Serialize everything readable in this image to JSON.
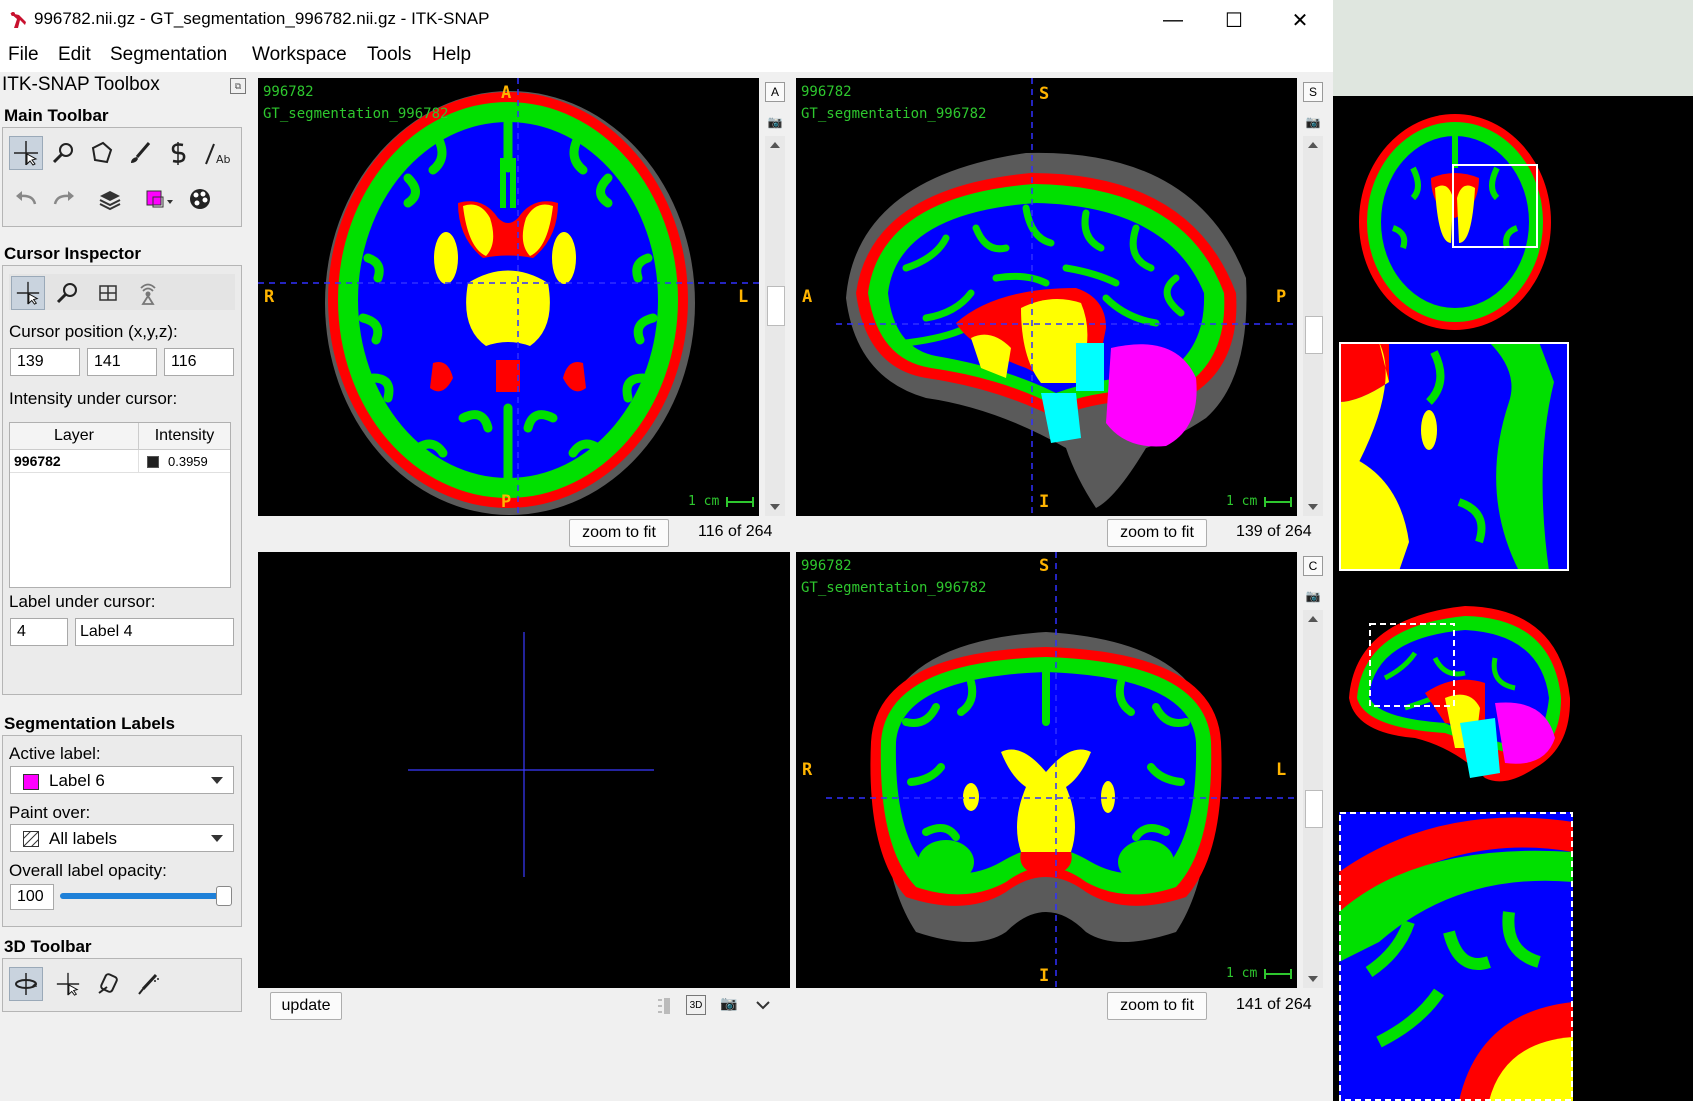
{
  "window": {
    "title": "996782.nii.gz - GT_segmentation_996782.nii.gz - ITK-SNAP",
    "minimize": "—",
    "maximize": "☐",
    "close": "✕"
  },
  "menu": [
    "File",
    "Edit",
    "Segmentation",
    "Workspace",
    "Tools",
    "Help"
  ],
  "toolbox": {
    "title": "ITK-SNAP Toolbox",
    "main_toolbar": "Main Toolbar",
    "cursor_inspector": {
      "title": "Cursor Inspector",
      "position_label": "Cursor position (x,y,z):",
      "x": "139",
      "y": "141",
      "z": "116",
      "intensity_label": "Intensity under cursor:",
      "table_headers": [
        "Layer",
        "Intensity"
      ],
      "rows": [
        {
          "layer": "996782",
          "intensity": "0.3959",
          "swatch": "#202020"
        }
      ],
      "label_under_cursor": "Label under cursor:",
      "label_id": "4",
      "label_name": "Label 4"
    },
    "segmentation_labels": {
      "title": "Segmentation Labels",
      "active_label_caption": "Active label:",
      "active_label": "Label 6",
      "active_color": "#ff00ff",
      "paint_over_caption": "Paint over:",
      "paint_over": "All labels",
      "opacity_caption": "Overall label opacity:",
      "opacity_value": "100",
      "opacity_fraction": 1.0
    },
    "toolbar_3d": "3D Toolbar"
  },
  "views": {
    "axial": {
      "image_name": "996782",
      "seg_name": "GT_segmentation_996782",
      "top": "A",
      "bottom": "P",
      "left": "R",
      "right": "L",
      "scale": "1 cm",
      "btn_letter": "A",
      "zoom": "zoom to fit",
      "slice": "116 of 264"
    },
    "sagittal": {
      "image_name": "996782",
      "seg_name": "GT_segmentation_996782",
      "top": "S",
      "bottom": "I",
      "left": "A",
      "right": "P",
      "scale": "1 cm",
      "btn_letter": "S",
      "zoom": "zoom to fit",
      "slice": "139 of 264"
    },
    "three_d": {
      "update": "update",
      "btn_3d": "3D"
    },
    "coronal": {
      "image_name": "996782",
      "seg_name": "GT_segmentation_996782",
      "top": "S",
      "bottom": "I",
      "left": "R",
      "right": "L",
      "scale": "1 cm",
      "btn_letter": "C",
      "zoom": "zoom to fit",
      "slice": "141 of 264"
    }
  },
  "colors": {
    "wm": "#0000ff",
    "gm": "#00ff00",
    "outer": "#ff0000",
    "deep": "#ffff00",
    "csf": "#00ffff",
    "cereb": "#ff00ff",
    "crosshair": "#3030ff",
    "overlay_text": "#2ec72e",
    "orient_text": "#ffb400"
  }
}
